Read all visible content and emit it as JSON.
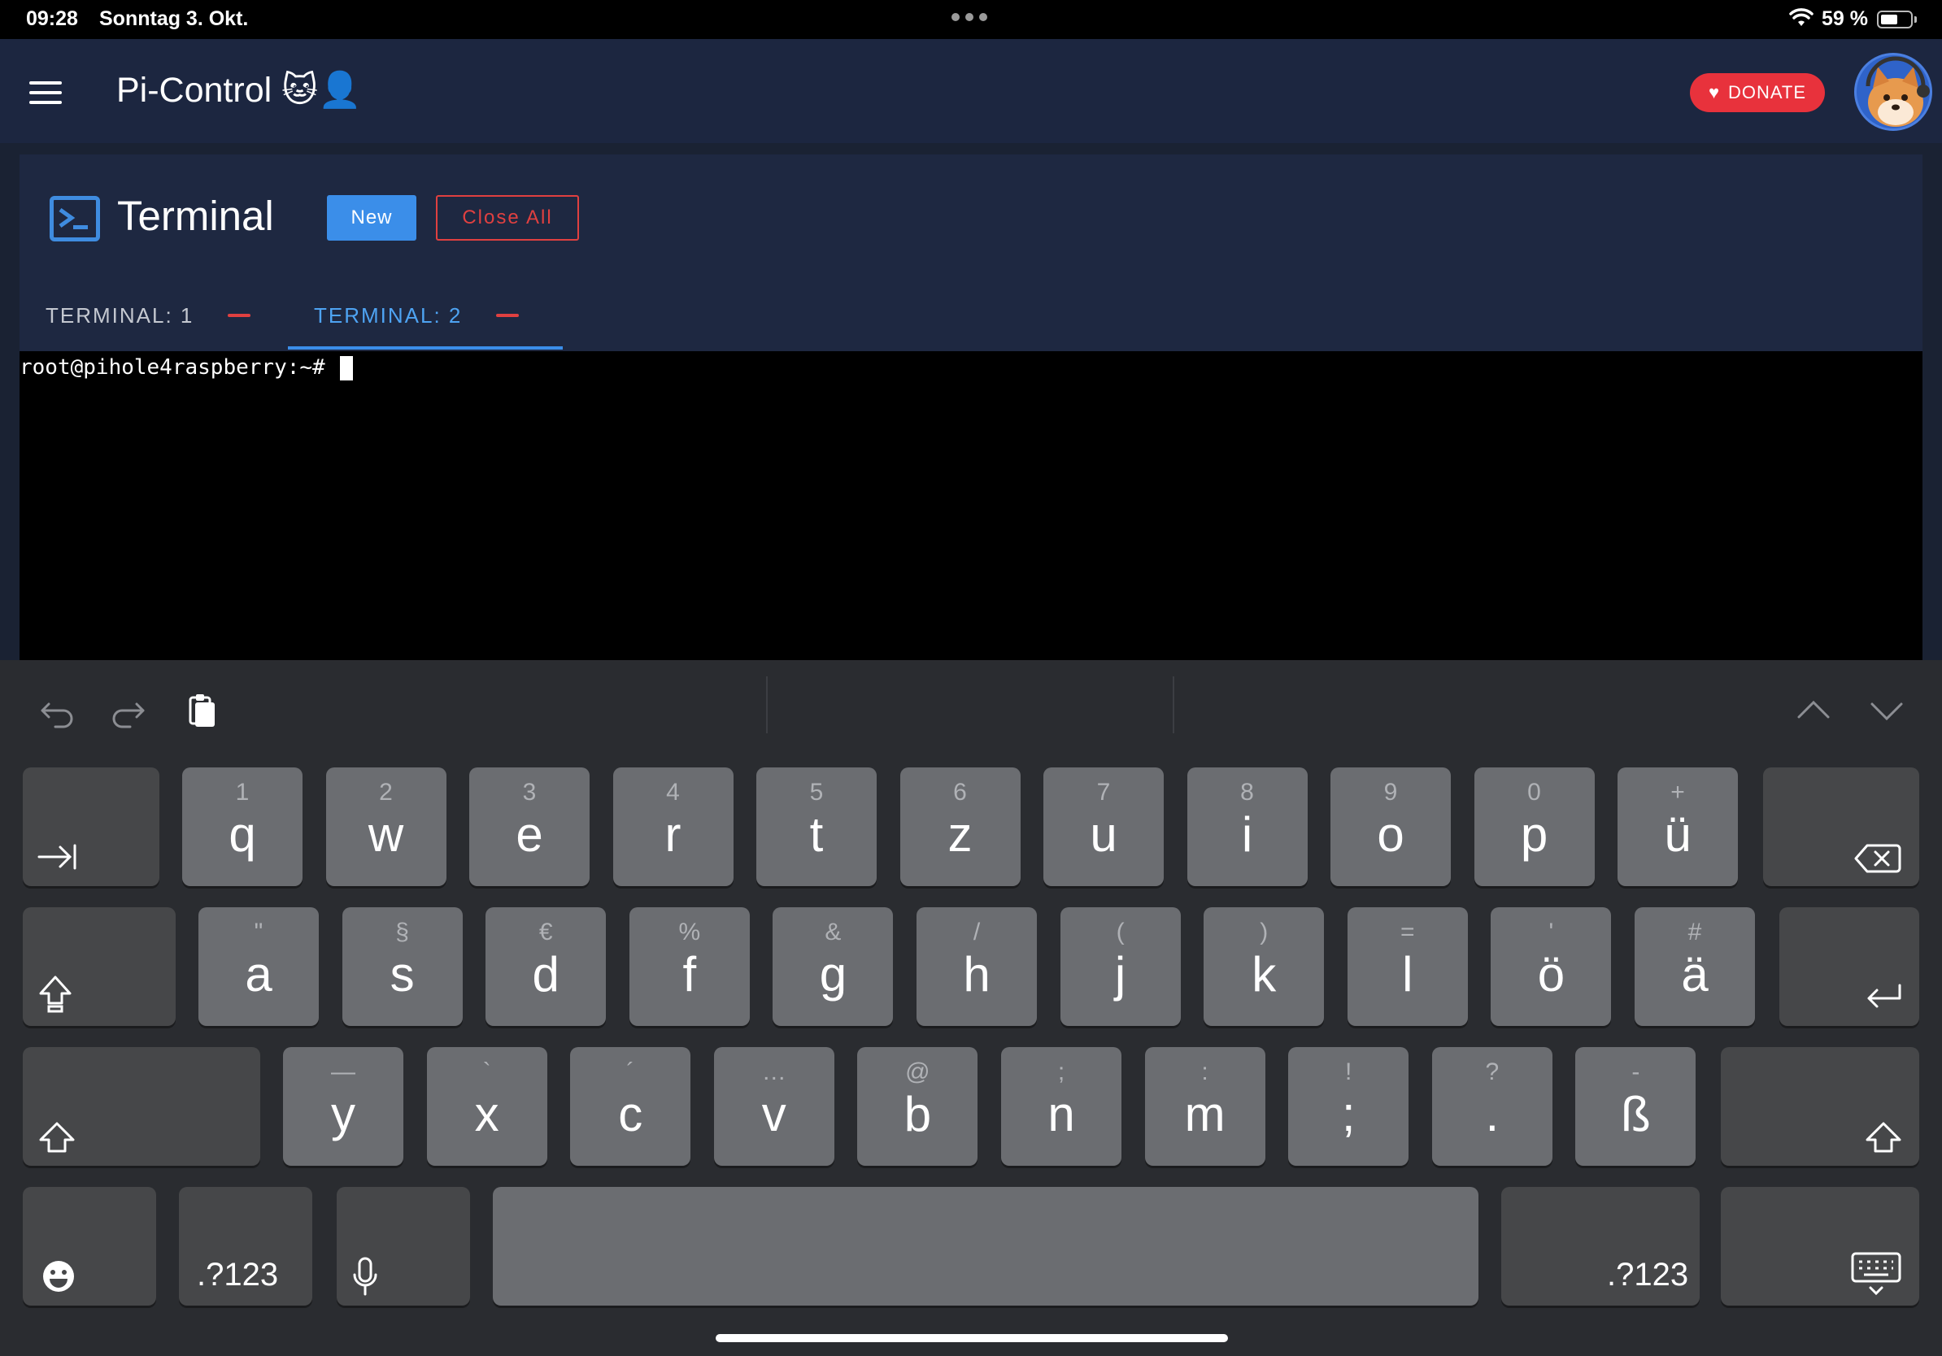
{
  "status_bar": {
    "time": "09:28",
    "date": "Sonntag 3. Okt.",
    "battery": "59 %",
    "battery_level": 0.59
  },
  "app_bar": {
    "title": "Pi-Control 🐱👤",
    "donate_label": "DONATE"
  },
  "page": {
    "title": "Terminal",
    "new_label": "New",
    "close_all_label": "Close All",
    "tabs": [
      {
        "label": "TERMINAL: 1",
        "active": false
      },
      {
        "label": "TERMINAL: 2",
        "active": true
      }
    ]
  },
  "terminal": {
    "prompt": "root@pihole4raspberry:~#"
  },
  "keyboard": {
    "row1": [
      {
        "main": "q",
        "sub": "1"
      },
      {
        "main": "w",
        "sub": "2"
      },
      {
        "main": "e",
        "sub": "3"
      },
      {
        "main": "r",
        "sub": "4"
      },
      {
        "main": "t",
        "sub": "5"
      },
      {
        "main": "z",
        "sub": "6"
      },
      {
        "main": "u",
        "sub": "7"
      },
      {
        "main": "i",
        "sub": "8"
      },
      {
        "main": "o",
        "sub": "9"
      },
      {
        "main": "p",
        "sub": "0"
      },
      {
        "main": "ü",
        "sub": "+"
      }
    ],
    "row2": [
      {
        "main": "a",
        "sub": "\""
      },
      {
        "main": "s",
        "sub": "§"
      },
      {
        "main": "d",
        "sub": "€"
      },
      {
        "main": "f",
        "sub": "%"
      },
      {
        "main": "g",
        "sub": "&"
      },
      {
        "main": "h",
        "sub": "/"
      },
      {
        "main": "j",
        "sub": "("
      },
      {
        "main": "k",
        "sub": ")"
      },
      {
        "main": "l",
        "sub": "="
      },
      {
        "main": "ö",
        "sub": "'"
      },
      {
        "main": "ä",
        "sub": "#"
      }
    ],
    "row3": [
      {
        "main": "y",
        "sub": "—"
      },
      {
        "main": "x",
        "sub": "`"
      },
      {
        "main": "c",
        "sub": "´"
      },
      {
        "main": "v",
        "sub": "…"
      },
      {
        "main": "b",
        "sub": "@"
      },
      {
        "main": "n",
        "sub": ";"
      },
      {
        "main": "m",
        "sub": ":"
      },
      {
        "main": ";",
        "sub": "!"
      },
      {
        "main": ".",
        "sub": "?"
      },
      {
        "main": "ß",
        "sub": "-"
      }
    ],
    "numbers_label": ".?123",
    "numbers_label_right": ".?123",
    "icons": {
      "undo": "undo-icon",
      "redo": "redo-icon",
      "paste": "paste-icon",
      "prev": "chevron-up-icon",
      "next": "chevron-down-icon",
      "tab": "tab-icon",
      "delete": "delete-icon",
      "capslock": "caps-lock-icon",
      "return": "return-icon",
      "shift": "shift-icon",
      "emoji": "emoji-icon",
      "mic": "microphone-icon",
      "dismiss": "keyboard-dismiss-icon"
    }
  }
}
